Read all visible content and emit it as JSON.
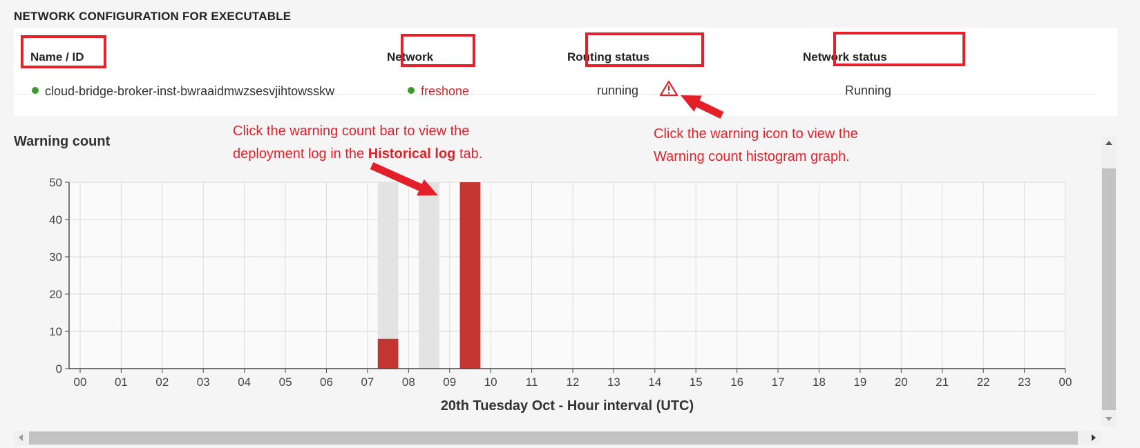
{
  "section": {
    "title": "NETWORK CONFIGURATION FOR EXECUTABLE"
  },
  "table": {
    "headers": [
      "Name / ID",
      "Network",
      "Routing status",
      "Network status"
    ],
    "row": {
      "name": "cloud-bridge-broker-inst-bwraaidmwzsesvjihtowsskw",
      "name_status_color": "#3b9b2c",
      "network": "freshone",
      "network_status_color": "#3b9b2c",
      "routing_status": "running",
      "routing_warning_icon": "warning-triangle-icon",
      "network_status": "Running"
    }
  },
  "chart_title": "Warning count",
  "annotations": {
    "bar_line1": "Click the warning count bar to view the",
    "bar_line2_before": "deployment log in the ",
    "bar_line2_bold": "Historical log",
    "bar_line2_after": " tab.",
    "icon_line1": "Click the warning icon to view the",
    "icon_line2": "Warning count histogram graph."
  },
  "colors": {
    "accent_red": "#e3202a",
    "bar_red": "#c23531",
    "bar_background": "#e3e3e3",
    "status_green": "#3b9b2c"
  },
  "chart_data": {
    "type": "bar",
    "categories": [
      "00",
      "01",
      "02",
      "03",
      "04",
      "05",
      "06",
      "07",
      "08",
      "09",
      "10",
      "11",
      "12",
      "13",
      "14",
      "15",
      "16",
      "17",
      "18",
      "19",
      "20",
      "21",
      "22",
      "23",
      "00"
    ],
    "values": [
      0,
      0,
      0,
      0,
      0,
      0,
      0,
      8,
      0,
      50,
      0,
      0,
      0,
      0,
      0,
      0,
      0,
      0,
      0,
      0,
      0,
      0,
      0,
      0
    ],
    "background_bars": [
      0,
      0,
      0,
      0,
      0,
      0,
      0,
      50,
      50,
      50,
      0,
      0,
      0,
      0,
      0,
      0,
      0,
      0,
      0,
      0,
      0,
      0,
      0,
      0
    ],
    "ylim": [
      0,
      50
    ],
    "yticks": [
      0,
      10,
      20,
      30,
      40,
      50
    ],
    "xlabel": "20th Tuesday Oct - Hour interval (UTC)",
    "ylabel": "",
    "grid": true,
    "bar_color": "#c23531"
  }
}
